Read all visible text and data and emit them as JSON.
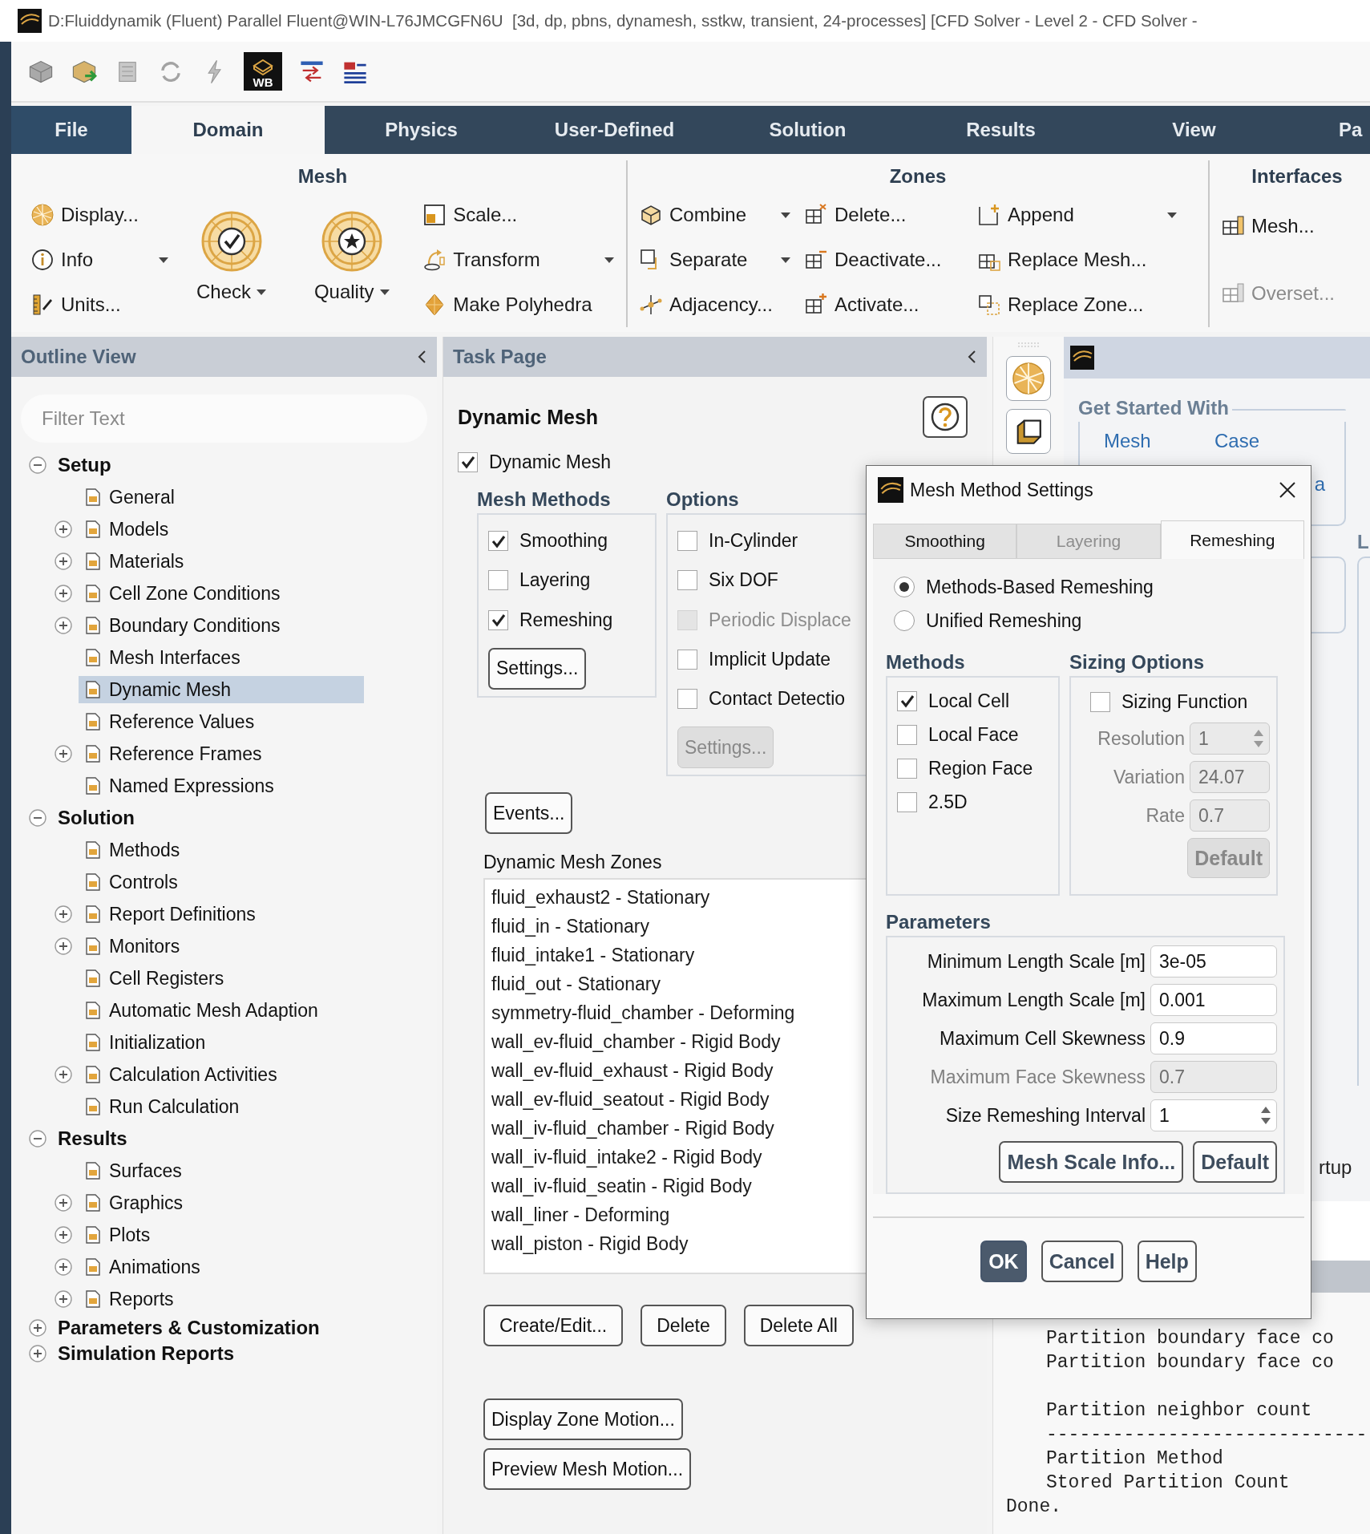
{
  "window": {
    "title": "D:Fluiddynamik (Fluent) Parallel Fluent@WIN-L76JMCGFN6U  [3d, dp, pbns, dynamesh, sstkw, transient, 24-processes] [CFD Solver - Level 2 - CFD Solver -"
  },
  "quick_access": {
    "workbench_label": "WB"
  },
  "ribbon_tabs": [
    {
      "label": "File",
      "selected": false
    },
    {
      "label": "Domain",
      "selected": true
    },
    {
      "label": "Physics",
      "selected": false
    },
    {
      "label": "User-Defined",
      "selected": false
    },
    {
      "label": "Solution",
      "selected": false
    },
    {
      "label": "Results",
      "selected": false
    },
    {
      "label": "View",
      "selected": false
    },
    {
      "label": "Pa",
      "selected": false
    }
  ],
  "ribbon_groups": [
    {
      "title": "Mesh",
      "columns": [
        {
          "kind": "stack",
          "items": [
            {
              "label": "Display...",
              "dropdown": false,
              "disabled": false
            },
            {
              "label": "Info",
              "dropdown": true,
              "disabled": false
            },
            {
              "label": "Units...",
              "dropdown": false,
              "disabled": false
            }
          ]
        },
        {
          "kind": "large",
          "label": "Check",
          "dropdown": true
        },
        {
          "kind": "large",
          "label": "Quality",
          "dropdown": true
        },
        {
          "kind": "stack",
          "items": [
            {
              "label": "Scale...",
              "dropdown": false,
              "disabled": false
            },
            {
              "label": "Transform",
              "dropdown": true,
              "disabled": false
            },
            {
              "label": "Make Polyhedra",
              "dropdown": false,
              "disabled": false
            }
          ]
        }
      ]
    },
    {
      "title": "Zones",
      "columns": [
        {
          "kind": "stack",
          "items": [
            {
              "label": "Combine",
              "dropdown": true,
              "disabled": false
            },
            {
              "label": "Separate",
              "dropdown": true,
              "disabled": false
            },
            {
              "label": "Adjacency...",
              "dropdown": false,
              "disabled": false
            }
          ]
        },
        {
          "kind": "stack",
          "items": [
            {
              "label": "Delete...",
              "dropdown": false,
              "disabled": false
            },
            {
              "label": "Deactivate...",
              "dropdown": false,
              "disabled": false
            },
            {
              "label": "Activate...",
              "dropdown": false,
              "disabled": false
            }
          ]
        },
        {
          "kind": "stack",
          "items": [
            {
              "label": "Append",
              "dropdown": true,
              "disabled": false
            },
            {
              "label": "Replace Mesh...",
              "dropdown": false,
              "disabled": false
            },
            {
              "label": "Replace Zone...",
              "dropdown": false,
              "disabled": false
            }
          ]
        }
      ]
    },
    {
      "title": "Interfaces",
      "columns": [
        {
          "kind": "stack",
          "items": [
            {
              "label": "Mesh...",
              "dropdown": false,
              "disabled": false
            },
            {
              "label": "Overset...",
              "dropdown": false,
              "disabled": true
            }
          ]
        }
      ]
    }
  ],
  "outline": {
    "title": "Outline View",
    "filter": {
      "placeholder": "Filter Text"
    },
    "tree": [
      {
        "label": "Setup",
        "expanded": true,
        "selected": false,
        "children": [
          {
            "label": "General",
            "selected": false
          },
          {
            "label": "Models",
            "expanded": false,
            "selected": false
          },
          {
            "label": "Materials",
            "expanded": false,
            "selected": false
          },
          {
            "label": "Cell Zone Conditions",
            "expanded": false,
            "selected": false
          },
          {
            "label": "Boundary Conditions",
            "expanded": false,
            "selected": false
          },
          {
            "label": "Mesh Interfaces",
            "selected": false
          },
          {
            "label": "Dynamic Mesh",
            "selected": true
          },
          {
            "label": "Reference Values",
            "selected": false
          },
          {
            "label": "Reference Frames",
            "expanded": false,
            "selected": false
          },
          {
            "label": "Named Expressions",
            "selected": false
          }
        ]
      },
      {
        "label": "Solution",
        "expanded": true,
        "selected": false,
        "children": [
          {
            "label": "Methods",
            "selected": false
          },
          {
            "label": "Controls",
            "selected": false
          },
          {
            "label": "Report Definitions",
            "expanded": false,
            "selected": false
          },
          {
            "label": "Monitors",
            "expanded": false,
            "selected": false
          },
          {
            "label": "Cell Registers",
            "selected": false
          },
          {
            "label": "Automatic Mesh Adaption",
            "selected": false
          },
          {
            "label": "Initialization",
            "selected": false
          },
          {
            "label": "Calculation Activities",
            "expanded": false,
            "selected": false
          },
          {
            "label": "Run Calculation",
            "selected": false
          }
        ]
      },
      {
        "label": "Results",
        "expanded": true,
        "selected": false,
        "children": [
          {
            "label": "Surfaces",
            "selected": false
          },
          {
            "label": "Graphics",
            "expanded": false,
            "selected": false
          },
          {
            "label": "Plots",
            "expanded": false,
            "selected": false
          },
          {
            "label": "Animations",
            "expanded": false,
            "selected": false
          },
          {
            "label": "Reports",
            "expanded": false,
            "selected": false
          }
        ]
      },
      {
        "label": "Parameters & Customization",
        "expanded": false,
        "selected": false
      },
      {
        "label": "Simulation Reports",
        "expanded": false,
        "selected": false
      }
    ]
  },
  "task_page": {
    "title": "Task Page",
    "heading": "Dynamic Mesh",
    "dynamic_mesh": {
      "label": "Dynamic Mesh",
      "checked": true
    },
    "mesh_methods": {
      "title": "Mesh Methods",
      "items": [
        {
          "label": "Smoothing",
          "checked": true,
          "disabled": false
        },
        {
          "label": "Layering",
          "checked": false,
          "disabled": false
        },
        {
          "label": "Remeshing",
          "checked": true,
          "disabled": false
        }
      ],
      "button": {
        "label": "Settings...",
        "disabled": false
      }
    },
    "options": {
      "title": "Options",
      "items": [
        {
          "label": "In-Cylinder",
          "checked": false,
          "disabled": false
        },
        {
          "label": "Six DOF",
          "checked": false,
          "disabled": false
        },
        {
          "label": "Periodic Displace",
          "checked": false,
          "disabled": true
        },
        {
          "label": "Implicit Update",
          "checked": false,
          "disabled": false
        },
        {
          "label": "Contact Detectio",
          "checked": false,
          "disabled": false
        }
      ],
      "button": {
        "label": "Settings...",
        "disabled": true
      }
    },
    "events_button": "Events...",
    "zones": {
      "title": "Dynamic Mesh Zones",
      "items": [
        "fluid_exhaust2 - Stationary",
        "fluid_in - Stationary",
        "fluid_intake1 - Stationary",
        "fluid_out - Stationary",
        "symmetry-fluid_chamber - Deforming",
        "wall_ev-fluid_chamber - Rigid Body",
        "wall_ev-fluid_exhaust - Rigid Body",
        "wall_ev-fluid_seatout - Rigid Body",
        "wall_iv-fluid_chamber - Rigid Body",
        "wall_iv-fluid_intake2 - Rigid Body",
        "wall_iv-fluid_seatin - Rigid Body",
        "wall_liner - Deforming",
        "wall_piston - Rigid Body"
      ]
    },
    "zone_buttons": [
      "Create/Edit...",
      "Delete",
      "Delete All"
    ],
    "motion_buttons": [
      "Display Zone Motion...",
      "Preview Mesh Motion..."
    ]
  },
  "graphics_panel": {
    "group_title": "Get Started With",
    "links": [
      "Mesh",
      "Case"
    ],
    "partial_link": "a",
    "side_group_title": "L",
    "partial_text": "rtup"
  },
  "console": {
    "blocks": [
      [
        "Partition boundary face co",
        "Partition boundary face co"
      ],
      [
        "Partition neighbor count",
        "-----------------------------",
        "Partition Method",
        "Stored Partition Count"
      ]
    ],
    "last_line": "Done."
  },
  "dialog": {
    "title": "Mesh Method Settings",
    "tabs": [
      {
        "label": "Smoothing",
        "selected": false,
        "disabled": false
      },
      {
        "label": "Layering",
        "selected": false,
        "disabled": true
      },
      {
        "label": "Remeshing",
        "selected": true,
        "disabled": false
      }
    ],
    "remeshing_modes": [
      {
        "label": "Methods-Based Remeshing",
        "selected": true
      },
      {
        "label": "Unified Remeshing",
        "selected": false
      }
    ],
    "methods": {
      "title": "Methods",
      "items": [
        {
          "label": "Local Cell",
          "checked": true
        },
        {
          "label": "Local Face",
          "checked": false
        },
        {
          "label": "Region Face",
          "checked": false
        },
        {
          "label": "2.5D",
          "checked": false
        }
      ]
    },
    "sizing": {
      "title": "Sizing Options",
      "sizing_function": {
        "label": "Sizing Function",
        "checked": false
      },
      "fields": [
        {
          "label": "Resolution",
          "value": "1",
          "kind": "spinner",
          "disabled": true
        },
        {
          "label": "Variation",
          "value": "24.07",
          "kind": "text",
          "disabled": true
        },
        {
          "label": "Rate",
          "value": "0.7",
          "kind": "text",
          "disabled": true
        }
      ],
      "default_button": {
        "label": "Default",
        "disabled": true
      }
    },
    "parameters": {
      "title": "Parameters",
      "fields": [
        {
          "label": "Minimum Length Scale [m]",
          "value": "3e-05",
          "kind": "text",
          "disabled": false
        },
        {
          "label": "Maximum Length Scale [m]",
          "value": "0.001",
          "kind": "text",
          "disabled": false
        },
        {
          "label": "Maximum Cell Skewness",
          "value": "0.9",
          "kind": "text",
          "disabled": false
        },
        {
          "label": "Maximum Face Skewness",
          "value": "0.7",
          "kind": "text",
          "disabled": true
        },
        {
          "label": "Size Remeshing Interval",
          "value": "1",
          "kind": "spinner",
          "disabled": false
        }
      ],
      "buttons": [
        "Mesh Scale Info...",
        "Default"
      ]
    },
    "buttons": [
      {
        "label": "OK",
        "primary": true
      },
      {
        "label": "Cancel",
        "primary": false
      },
      {
        "label": "Help",
        "primary": false
      }
    ]
  }
}
